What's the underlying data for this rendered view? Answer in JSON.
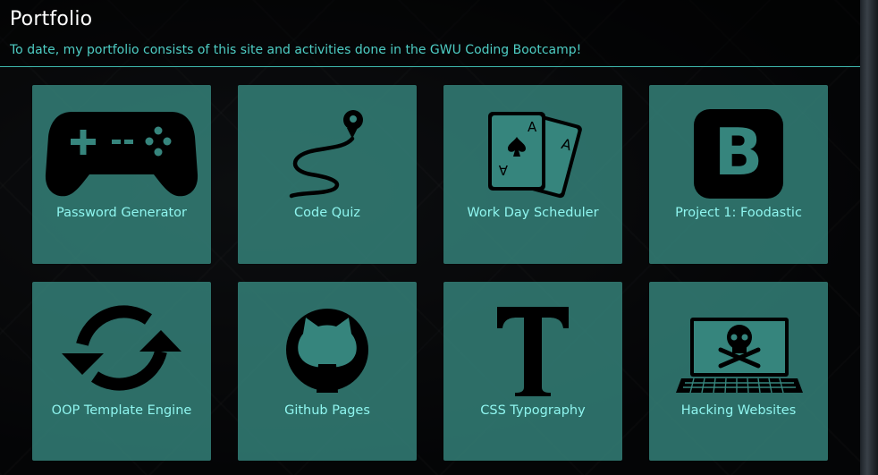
{
  "header": {
    "title": "Portfolio",
    "subtitle": "To date, my portfolio consists of this site and activities done in the GWU Coding Bootcamp!"
  },
  "projects": [
    {
      "label": "Password Generator",
      "icon": "gamepad-icon"
    },
    {
      "label": "Code Quiz",
      "icon": "route-pin-icon"
    },
    {
      "label": "Work Day Scheduler",
      "icon": "playing-cards-icon"
    },
    {
      "label": "Project 1: Foodastic",
      "icon": "bootstrap-icon"
    },
    {
      "label": "OOP Template Engine",
      "icon": "sync-arrows-icon"
    },
    {
      "label": "Github Pages",
      "icon": "github-icon"
    },
    {
      "label": "CSS Typography",
      "icon": "typography-icon"
    },
    {
      "label": "Hacking Websites",
      "icon": "laptop-skull-icon"
    }
  ],
  "colors": {
    "accent": "#4ecdc4",
    "card": "#36857d",
    "label": "#8ff5ef"
  }
}
